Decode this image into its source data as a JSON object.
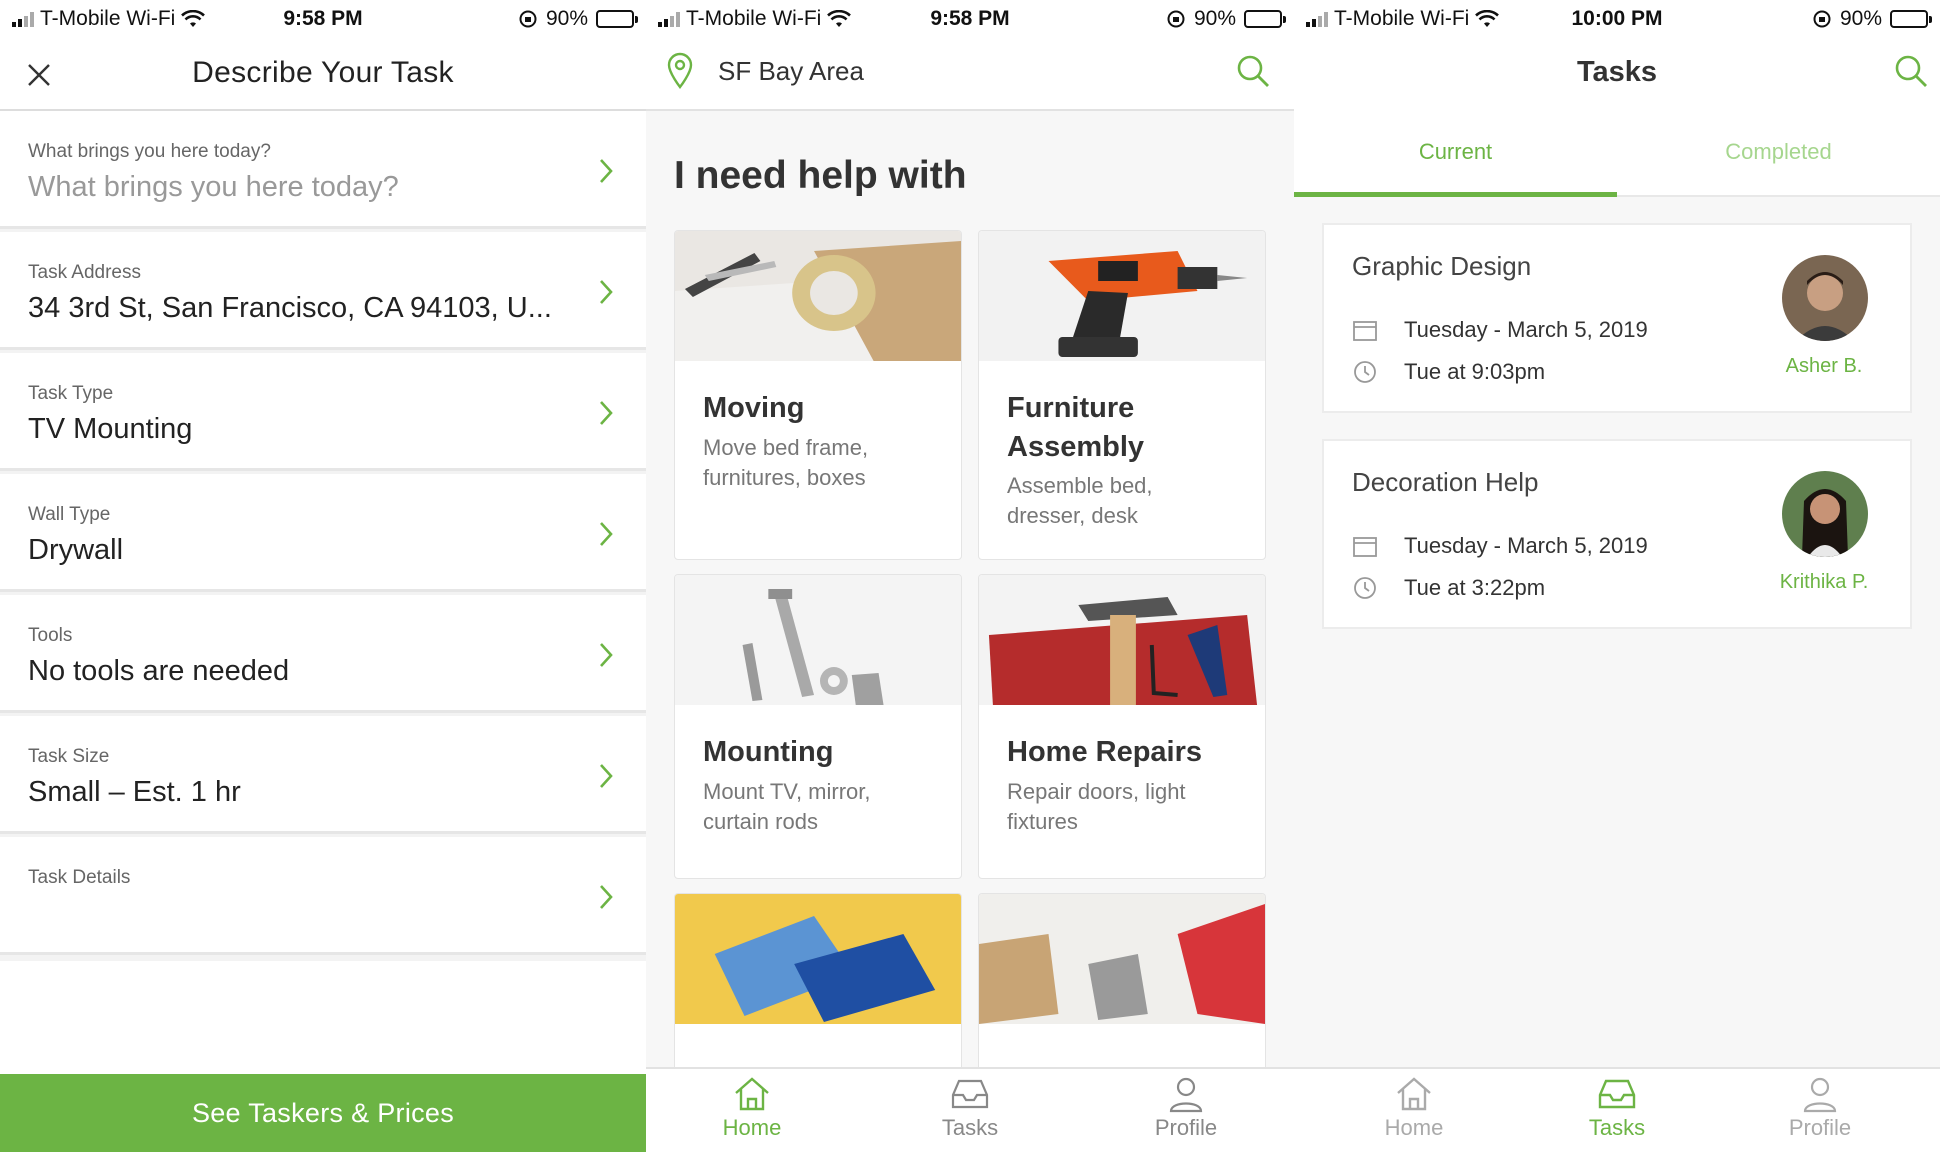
{
  "status_bars": [
    {
      "carrier": "T-Mobile Wi-Fi",
      "time": "9:58 PM",
      "battery": "90%"
    },
    {
      "carrier": "T-Mobile Wi-Fi",
      "time": "9:58 PM",
      "battery": "90%"
    },
    {
      "carrier": "T-Mobile Wi-Fi",
      "time": "10:00 PM",
      "battery": "90%"
    }
  ],
  "describe": {
    "title": "Describe Your Task",
    "rows": [
      {
        "label": "What brings you here today?",
        "value": "What brings you here today?",
        "placeholder": true
      },
      {
        "label": "Task Address",
        "value": "34 3rd St, San Francisco, CA 94103, U..."
      },
      {
        "label": "Task Type",
        "value": "TV Mounting"
      },
      {
        "label": "Wall Type",
        "value": "Drywall"
      },
      {
        "label": "Tools",
        "value": "No tools are needed"
      },
      {
        "label": "Task Size",
        "value": "Small – Est. 1 hr"
      },
      {
        "label": "Task Details",
        "value": ""
      }
    ],
    "cta": "See Taskers & Prices"
  },
  "home": {
    "location": "SF Bay Area",
    "heading": "I need help with",
    "categories": [
      {
        "name": "Moving",
        "desc": "Move bed frame, furnitures, boxes"
      },
      {
        "name": "Furniture Assembly",
        "desc": "Assemble bed, dresser, desk"
      },
      {
        "name": "Mounting",
        "desc": "Mount TV, mirror, curtain rods"
      },
      {
        "name": "Home Repairs",
        "desc": "Repair doors, light fixtures"
      }
    ],
    "tabs": [
      "Home",
      "Tasks",
      "Profile"
    ]
  },
  "tasks": {
    "title": "Tasks",
    "tabs": [
      "Current",
      "Completed"
    ],
    "items": [
      {
        "title": "Graphic Design",
        "date": "Tuesday - March 5, 2019",
        "time": "Tue at 9:03pm",
        "tasker": "Asher B."
      },
      {
        "title": "Decoration Help",
        "date": "Tuesday - March 5, 2019",
        "time": "Tue at 3:22pm",
        "tasker": "Krithika P."
      }
    ],
    "nav": [
      "Home",
      "Tasks",
      "Profile"
    ]
  },
  "colors": {
    "accent": "#6cb444"
  }
}
